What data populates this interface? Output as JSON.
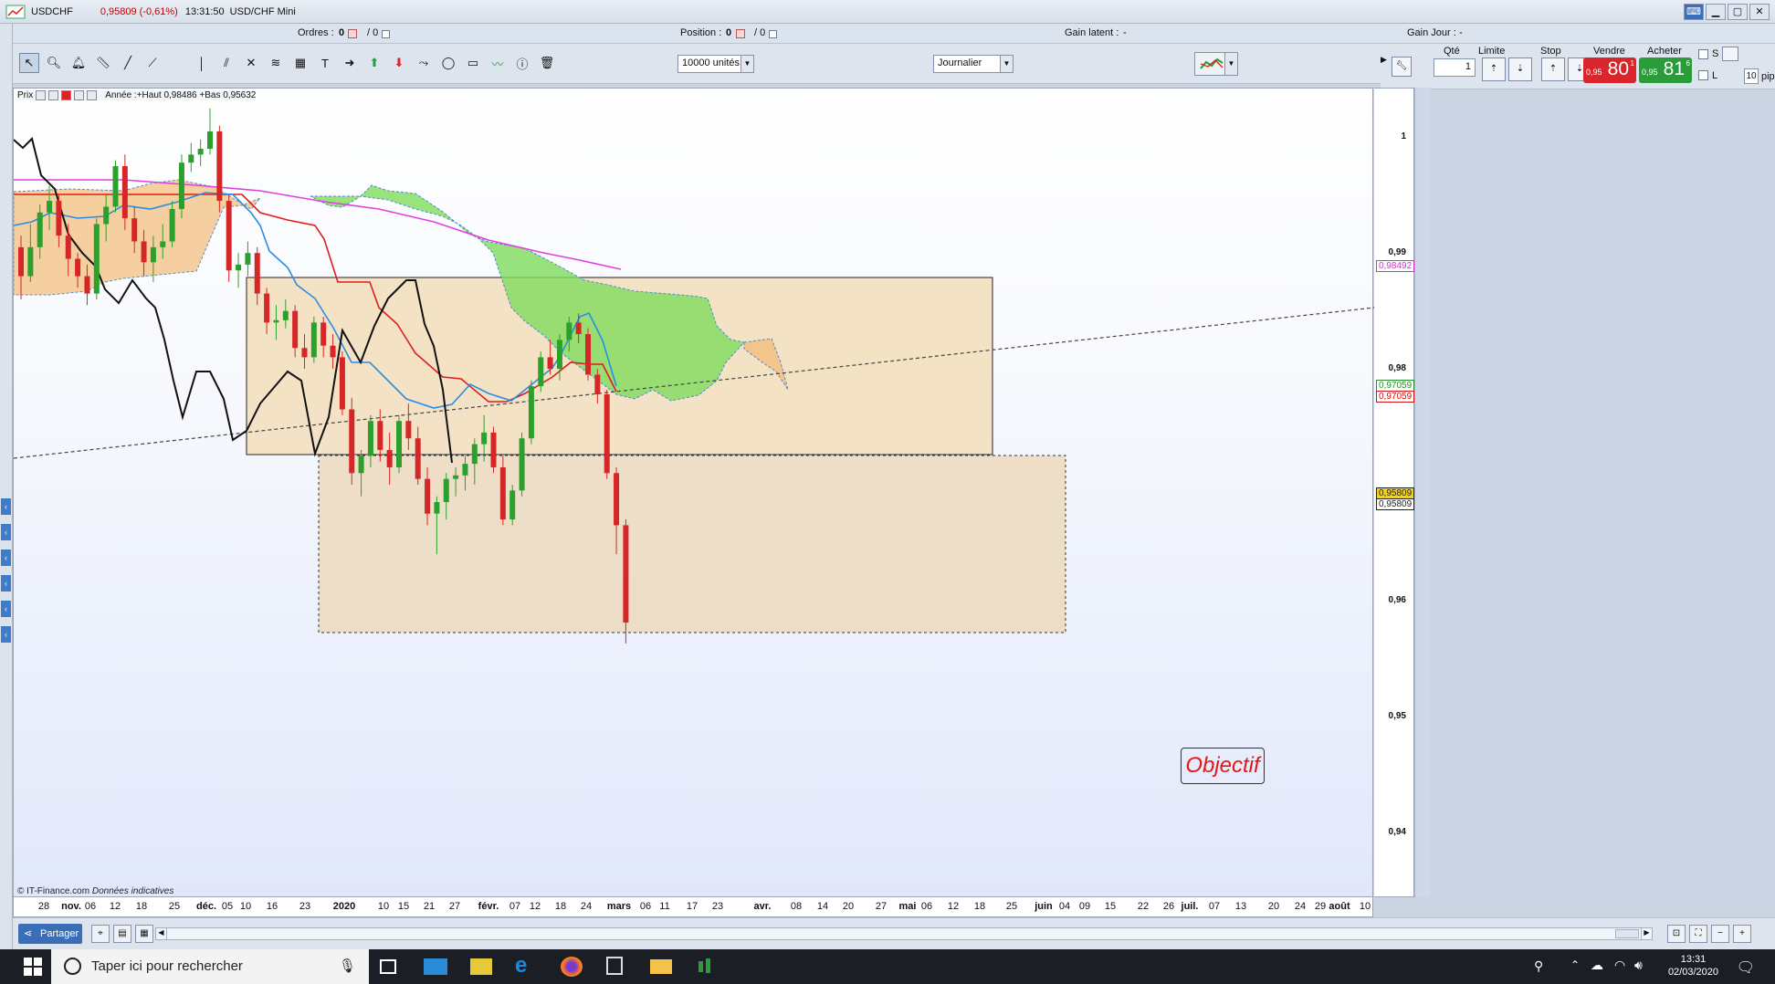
{
  "window": {
    "symbol": "USDCHF",
    "price_change": "0,95809 (-0,61%)",
    "time": "13:31:50",
    "title": "USD/CHF Mini"
  },
  "info_bar": {
    "orders_label": "Ordres :",
    "orders_value": "0",
    "orders_sep": "/ 0",
    "position_label": "Position :",
    "position_value": "0",
    "position_sep": "/ 0",
    "latent_label": "Gain latent :",
    "latent_value": "-",
    "day_label": "Gain Jour :",
    "day_value": "-"
  },
  "toolbar": {
    "units_select": "10000 unités",
    "period_select": "Journalier"
  },
  "order_panel": {
    "qty_label": "Qté",
    "qty_value": "1",
    "limit_label": "Limite",
    "stop_label": "Stop",
    "sell_label": "Vendre",
    "buy_label": "Acheter",
    "sell_small": "0,95",
    "sell_big": "80",
    "sell_tiny": "1",
    "buy_small": "0,95",
    "buy_big": "81",
    "buy_tiny": "6",
    "s_label": "S",
    "l_label": "L",
    "pips_value": "10",
    "pips_label": "pips"
  },
  "legend": {
    "prix": "Prix",
    "annee": "Année :+Haut 0,98486 +Bas 0,95632"
  },
  "chart_data": {
    "type": "candlestick",
    "y_range": [
      0.9343,
      1.0042
    ],
    "y_ticks": [
      "1",
      "0,99",
      "0,98",
      "0,96",
      "0,95",
      "0,94"
    ],
    "price_labels": [
      {
        "text": "0,98492",
        "color": "#cc33cc"
      },
      {
        "text": "0,97059",
        "color": "#2a8c2a"
      },
      {
        "text": "0,97059",
        "color": "#cc1111"
      },
      {
        "text": "0,95809",
        "color": "#222222",
        "bg": "#f2d21b"
      },
      {
        "text": "0,95809",
        "color": "#222222",
        "bg": "#ffffff"
      }
    ],
    "annotation": "Objectif",
    "x_labels": [
      "28",
      "nov.",
      "06",
      "12",
      "18",
      "25",
      "déc.",
      "05",
      "10",
      "16",
      "23",
      "2020",
      "10",
      "15",
      "21",
      "27",
      "févr.",
      "07",
      "12",
      "18",
      "24",
      "mars",
      "06",
      "11",
      "17",
      "23",
      "avr.",
      "08",
      "14",
      "20",
      "27",
      "mai",
      "06",
      "12",
      "18",
      "25",
      "juin",
      "04",
      "09",
      "15",
      "22",
      "26",
      "juil.",
      "07",
      "13",
      "20",
      "24",
      "29",
      "août",
      "10"
    ],
    "x_labels_bold": [
      "nov.",
      "déc.",
      "2020",
      "févr.",
      "mars",
      "avr.",
      "mai",
      "juin",
      "juil.",
      "août"
    ],
    "colors": {
      "bull": "#2ca02c",
      "bear": "#d62728",
      "ma200": "#e040e0",
      "kijun": "#e01c1c",
      "tenkan": "#2b8ce6",
      "chikou": "#111111",
      "kumo_bull": "#7fdc5c",
      "kumo_bear": "#f3c07f"
    }
  },
  "footer": {
    "copyright": "© IT-Finance.com",
    "note": "Données indicatives",
    "share": "Partager"
  },
  "taskbar": {
    "search_placeholder": "Taper ici pour rechercher",
    "time": "13:31",
    "date": "02/03/2020"
  }
}
